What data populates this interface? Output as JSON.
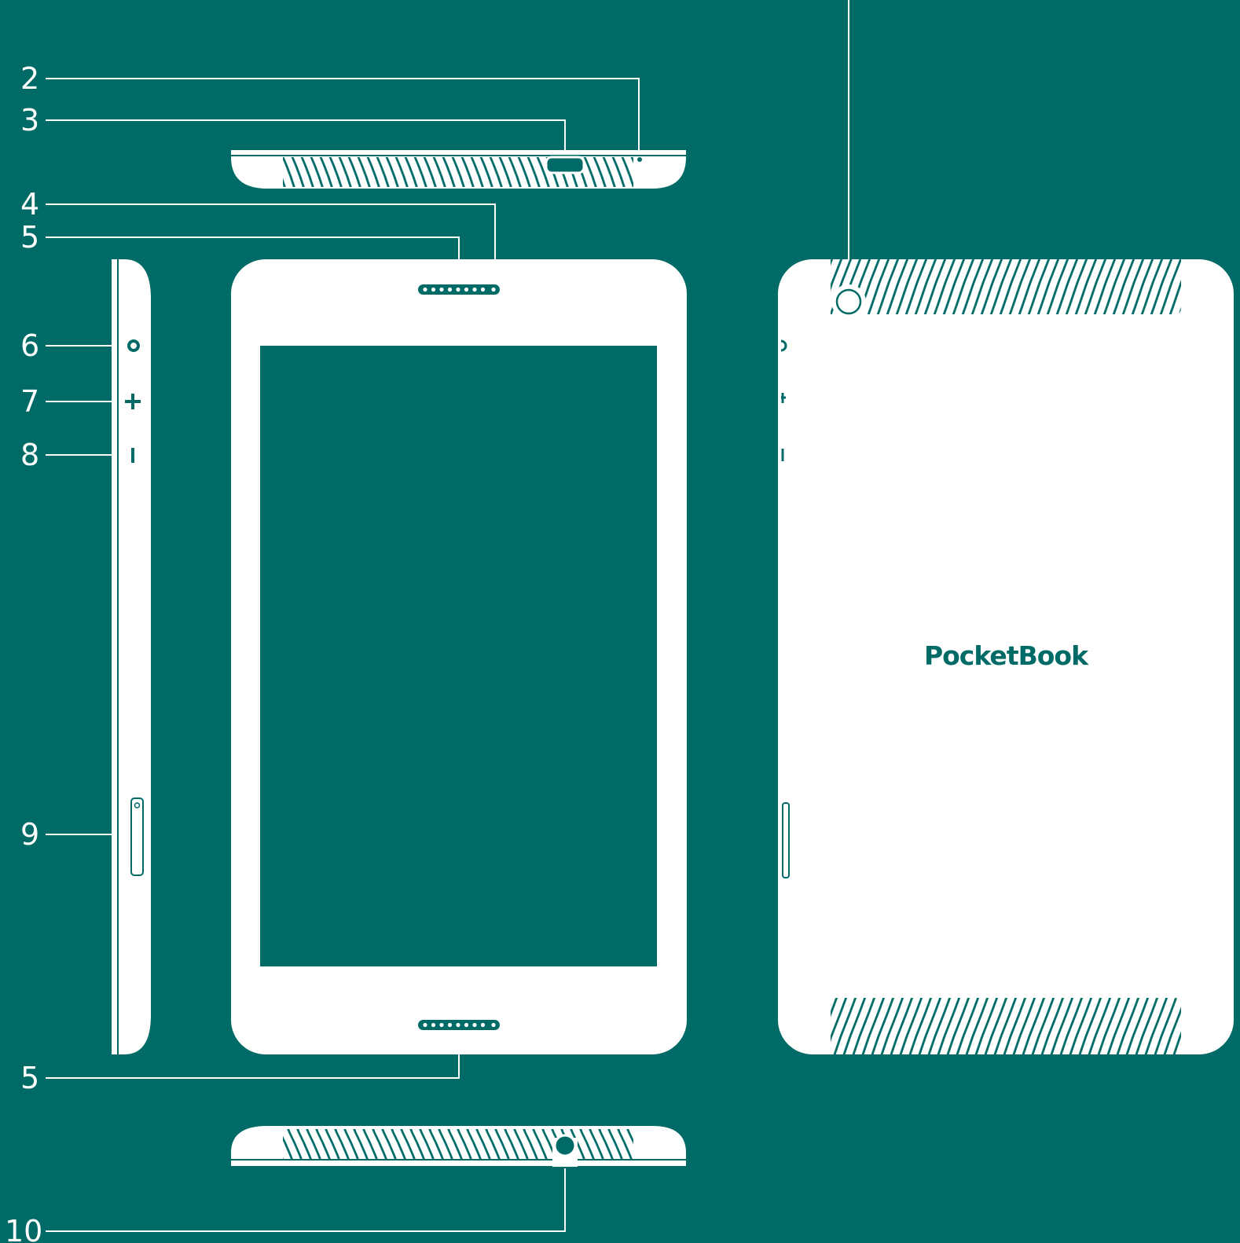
{
  "colors": {
    "background": "#006b66",
    "device": "#ffffff"
  },
  "callouts": {
    "top_partial": "",
    "c2": "2",
    "c3": "3",
    "c4": "4",
    "c5_top": "5",
    "c6": "6",
    "c7": "7",
    "c8": "8",
    "c9": "9",
    "c5_bottom": "5",
    "c10": "10"
  },
  "back_view": {
    "brand_logo": "PocketBook"
  },
  "icons": {
    "side_power": "power-button-icon",
    "side_plus": "volume-up-icon",
    "side_minus": "volume-down-icon",
    "side_slot": "card-slot-icon",
    "camera": "camera-icon",
    "micro_usb": "micro-usb-port-icon",
    "headphone": "headphone-jack-icon"
  }
}
